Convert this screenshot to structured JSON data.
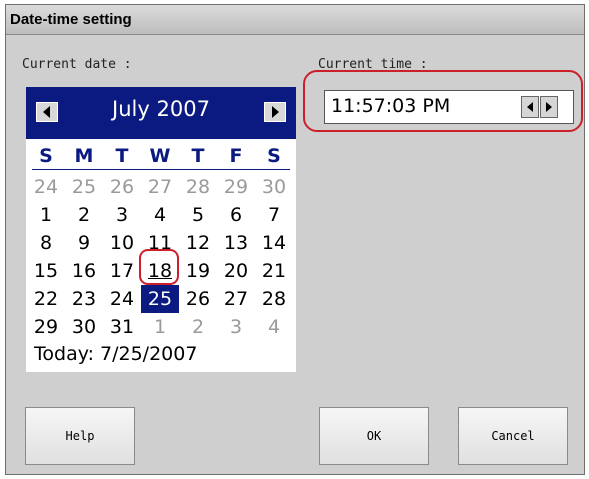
{
  "dialog": {
    "title": "Date-time setting",
    "current_date_label": "Current date :",
    "current_time_label": "Current time :"
  },
  "calendar": {
    "month_label": "July 2007",
    "weekdays": [
      "S",
      "M",
      "T",
      "W",
      "T",
      "F",
      "S"
    ],
    "weeks": [
      [
        "24",
        "25",
        "26",
        "27",
        "28",
        "29",
        "30"
      ],
      [
        "1",
        "2",
        "3",
        "4",
        "5",
        "6",
        "7"
      ],
      [
        "8",
        "9",
        "10",
        "11",
        "12",
        "13",
        "14"
      ],
      [
        "15",
        "16",
        "17",
        "18",
        "19",
        "20",
        "21"
      ],
      [
        "22",
        "23",
        "24",
        "25",
        "26",
        "27",
        "28"
      ],
      [
        "29",
        "30",
        "31",
        "1",
        "2",
        "3",
        "4"
      ]
    ],
    "today_label": "Today: 7/25/2007",
    "colors": {
      "header": "#0a1a80",
      "highlight_ring": "#cc1f2a"
    }
  },
  "time": {
    "value": "11:57:03 PM"
  },
  "buttons": {
    "help": "Help",
    "ok": "OK",
    "cancel": "Cancel"
  }
}
